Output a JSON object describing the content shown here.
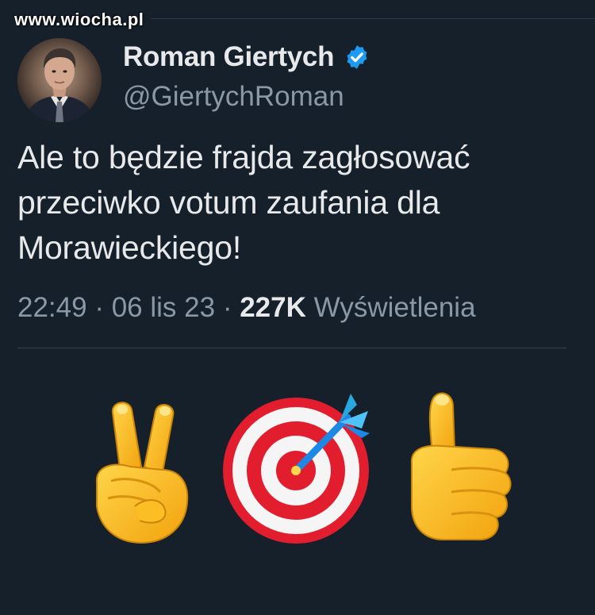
{
  "watermark": "www.wiocha.pl",
  "author": {
    "display_name": "Roman Giertych",
    "handle": "@GiertychRoman",
    "verified_color": "#1d9bf0"
  },
  "tweet": {
    "lines": [
      "Ale to będzie frajda zagłosować",
      "przeciwko votum zaufania dla",
      "Morawieckiego!"
    ],
    "time": "22:49",
    "separator": "·",
    "date": "06 lis 23",
    "views_count": "227K",
    "views_label": "Wyświetlenia"
  },
  "emojis": [
    "victory-hand",
    "direct-hit",
    "thumbs-up"
  ],
  "colors": {
    "background": "#15202b",
    "text": "#e7e9ea",
    "secondary": "#8b98a5"
  }
}
